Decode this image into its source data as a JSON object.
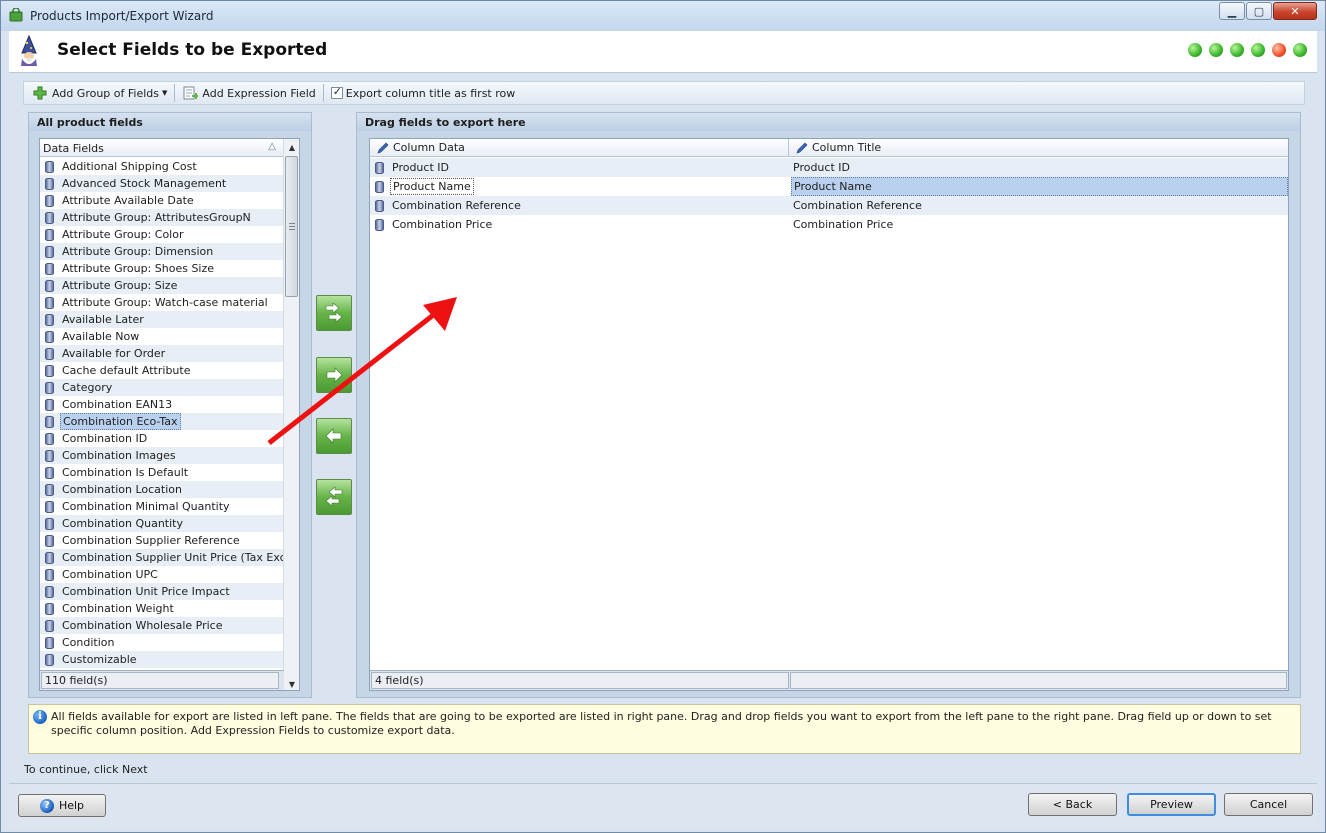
{
  "window": {
    "title": "Products Import/Export Wizard",
    "minimize_glyph": "▁",
    "maximize_glyph": "▢",
    "close_glyph": "✕"
  },
  "header": {
    "title": "Select Fields to be Exported",
    "steps": [
      "done",
      "done",
      "done",
      "done",
      "current",
      "done"
    ]
  },
  "toolbar": {
    "add_group_label": "Add Group of Fields",
    "add_expression_label": "Add Expression Field",
    "export_title_label": "Export column title as first row",
    "export_title_checked": true
  },
  "left_panel": {
    "title": "All product fields",
    "column_header": "Data Fields",
    "fields": [
      "Additional Shipping Cost",
      "Advanced Stock Management",
      "Attribute Available Date",
      "Attribute Group: AttributesGroupN",
      "Attribute Group: Color",
      "Attribute Group: Dimension",
      "Attribute Group: Shoes Size",
      "Attribute Group: Size",
      "Attribute Group: Watch-case material",
      "Available Later",
      "Available Now",
      "Available for Order",
      "Cache default Attribute",
      "Category",
      "Combination EAN13",
      "Combination Eco-Tax",
      "Combination ID",
      "Combination Images",
      "Combination Is Default",
      "Combination Location",
      "Combination Minimal Quantity",
      "Combination Quantity",
      "Combination Supplier Reference",
      "Combination Supplier Unit Price (Tax Excl.)",
      "Combination UPC",
      "Combination Unit Price Impact",
      "Combination Weight",
      "Combination Wholesale Price",
      "Condition",
      "Customizable"
    ],
    "selected_field": "Combination Eco-Tax",
    "footer": "110 field(s)"
  },
  "right_panel": {
    "title": "Drag fields to export here",
    "col_data_header": "Column Data",
    "col_title_header": "Column Title",
    "rows": [
      {
        "data": "Product ID",
        "title": "Product ID"
      },
      {
        "data": "Product Name",
        "title": "Product Name"
      },
      {
        "data": "Combination Reference",
        "title": "Combination Reference"
      },
      {
        "data": "Combination Price",
        "title": "Combination Price"
      }
    ],
    "selected_row": "Product Name",
    "footer": "4 field(s)"
  },
  "info": {
    "text": "All fields available for export are listed in left pane. The fields that are going to be exported are listed in right pane. Drag and drop fields you want to export from the left pane to the right pane. Drag field up or down to set specific column position. Add Expression Fields to customize export data."
  },
  "continue_text": "To continue, click Next",
  "buttons": {
    "help": "Help",
    "back": "< Back",
    "preview": "Preview",
    "cancel": "Cancel"
  },
  "colors": {
    "accent_green": "#4b9a32",
    "step_current": "#f0512a",
    "selection": "#b9d1ee",
    "annotation_arrow": "#ee1111"
  }
}
